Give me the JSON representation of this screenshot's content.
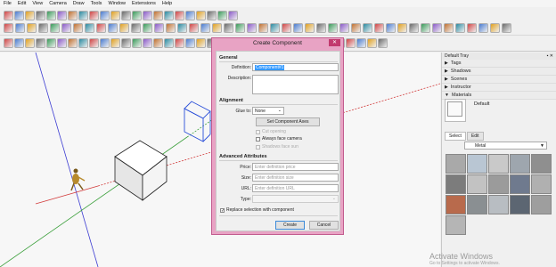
{
  "menu": [
    "File",
    "Edit",
    "View",
    "Camera",
    "Draw",
    "Tools",
    "Window",
    "Extensions",
    "Help"
  ],
  "tray": {
    "title": "Default Tray",
    "panels": [
      "Tags",
      "Shadows",
      "Scenes",
      "Instructor",
      "Materials"
    ],
    "material_name": "Default",
    "tabs": [
      "Select",
      "Edit"
    ],
    "collection": "Metal",
    "swatch_colors": [
      "#a9a9a9",
      "#b9c6d3",
      "#c9c9c9",
      "#9ea6ae",
      "#8f8f8f",
      "#7c7c7c",
      "#c2c2c2",
      "#9b9b9b",
      "#6f7a8e",
      "#b0b0b0",
      "#b86a4c",
      "#8a8f92",
      "#b8bdc2",
      "#5c6672",
      "#9e9e9e",
      "#b5b5b5"
    ]
  },
  "watermark": {
    "title": "Activate Windows",
    "subtitle": "Go to Settings to activate Windows."
  },
  "dialog": {
    "title": "Create Component",
    "general_label": "General",
    "definition_label": "Definition:",
    "definition_value": "Component#1",
    "description_label": "Description:",
    "alignment_label": "Alignment",
    "glue_label": "Glue to:",
    "glue_value": "None",
    "set_axes_label": "Set Component Axes",
    "cut_opening_label": "Cut opening",
    "face_camera_label": "Always face camera",
    "shadows_sun_label": "Shadows face sun",
    "advanced_label": "Advanced Attributes",
    "price_label": "Price:",
    "price_placeholder": "Enter definition price",
    "size_label": "Size:",
    "size_placeholder": "Enter definition size",
    "url_label": "URL:",
    "url_placeholder": "Enter definition URL",
    "type_label": "Type:",
    "type_value": "",
    "replace_label": "Replace selection with component",
    "create_label": "Create",
    "cancel_label": "Cancel"
  },
  "colors": {
    "dialog_frame": "#e8a3c4",
    "axis_red": "#d23c3c",
    "axis_green": "#3ca03c",
    "axis_blue": "#3c3cd2"
  }
}
